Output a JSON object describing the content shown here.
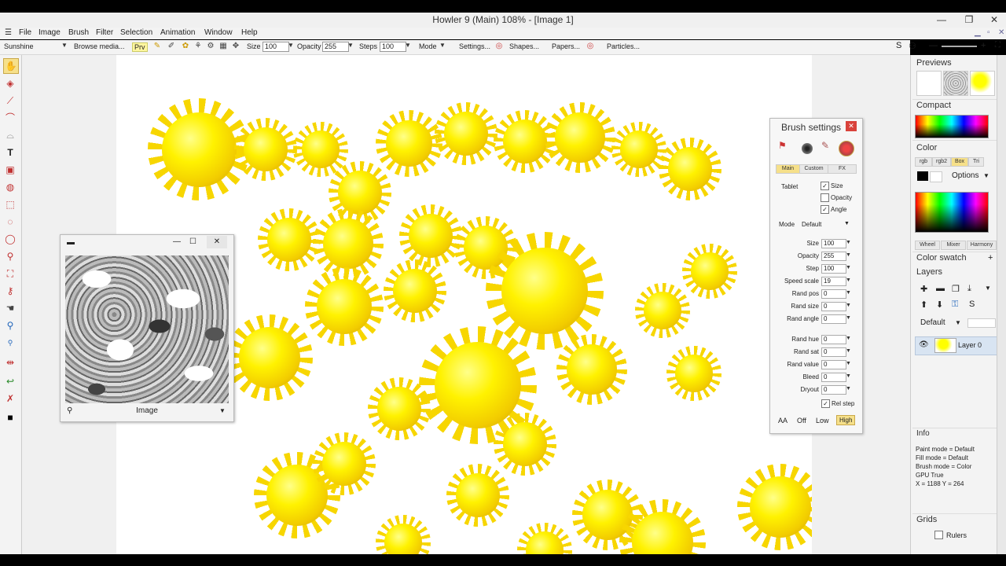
{
  "window": {
    "title": "Howler 9  (Main)  108%   - [Image 1]"
  },
  "menu": [
    "File",
    "Image",
    "Brush",
    "Filter",
    "Selection",
    "Animation",
    "Window",
    "Help"
  ],
  "toolbar": {
    "preset": "Sunshine",
    "browse": "Browse media...",
    "prv": "Prv",
    "size_label": "Size",
    "size_value": "100",
    "opacity_label": "Opacity",
    "opacity_value": "255",
    "steps_label": "Steps",
    "steps_value": "100",
    "mode_label": "Mode",
    "settings": "Settings...",
    "shapes": "Shapes...",
    "papers": "Papers...",
    "particles": "Particles..."
  },
  "brush_settings": {
    "title": "Brush settings",
    "tabs": [
      "Main",
      "Custom",
      "FX"
    ],
    "tablet_label": "Tablet",
    "checks": [
      {
        "label": "Size",
        "checked": true
      },
      {
        "label": "Opacity",
        "checked": false
      },
      {
        "label": "Angle",
        "checked": true
      }
    ],
    "mode_label": "Mode",
    "mode_value": "Default",
    "params": [
      {
        "label": "Size",
        "value": "100"
      },
      {
        "label": "Opacity",
        "value": "255"
      },
      {
        "label": "Step",
        "value": "100"
      },
      {
        "label": "Speed scale",
        "value": "19"
      },
      {
        "label": "Rand pos",
        "value": "0"
      },
      {
        "label": "Rand size",
        "value": "0"
      },
      {
        "label": "Rand angle",
        "value": "0"
      },
      {
        "label": "Rand hue",
        "value": "0"
      },
      {
        "label": "Rand sat",
        "value": "0"
      },
      {
        "label": "Rand value",
        "value": "0"
      },
      {
        "label": "Bleed",
        "value": "0"
      },
      {
        "label": "Dryout",
        "value": "0"
      }
    ],
    "rel_step_label": "Rel step",
    "aa_label": "AA",
    "aa_options": [
      "Off",
      "Low",
      "High"
    ]
  },
  "image_window": {
    "label": "Image"
  },
  "right_panel": {
    "previews": "Previews",
    "compact": "Compact",
    "color": "Color",
    "color_tabs": [
      "rgb",
      "rgb2",
      "Box",
      "Tri"
    ],
    "options": "Options",
    "mix_tabs": [
      "Wheel",
      "Mixer",
      "Harmony"
    ],
    "color_swatch": "Color swatch",
    "layers": "Layers",
    "layer_mode": "Default",
    "layer_name": "Layer 0",
    "info_title": "Info",
    "info_lines": [
      "Paint mode = Default",
      "Fill mode = Default",
      "Brush mode = Color",
      "GPU  True",
      "X =  1188  Y =  264"
    ],
    "grids": "Grids",
    "rulers": "Rulers"
  },
  "colors": {
    "accent": "#e03030",
    "sun": "#fff200"
  }
}
